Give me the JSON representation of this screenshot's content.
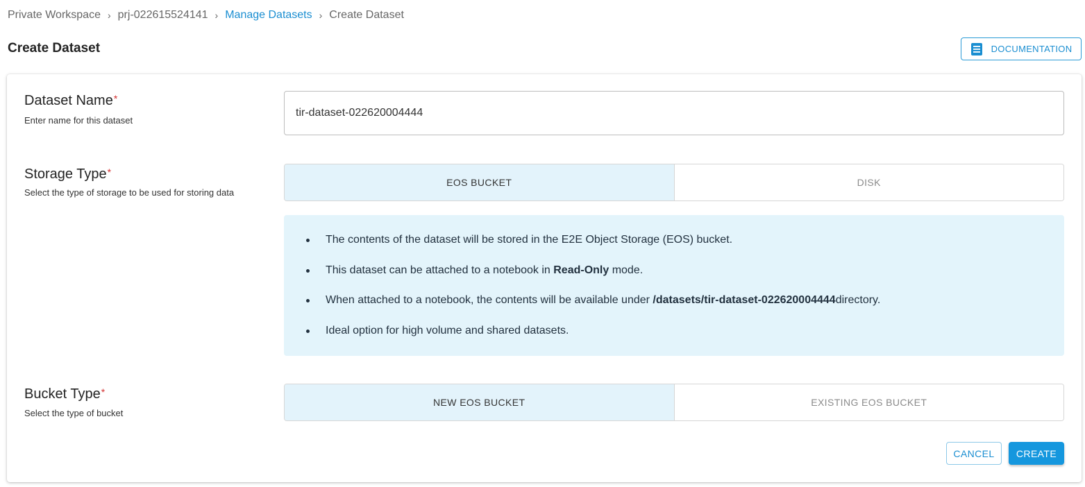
{
  "breadcrumb": {
    "items": [
      "Private Workspace",
      "prj-022615524141",
      "Manage Datasets",
      "Create Dataset"
    ],
    "separator": "›"
  },
  "page": {
    "title": "Create Dataset",
    "documentation_label": "DOCUMENTATION",
    "documentation_icon": "document-icon"
  },
  "form": {
    "dataset_name": {
      "label": "Dataset Name",
      "required_mark": "*",
      "help": "Enter name for this dataset",
      "value": "tir-dataset-022620004444"
    },
    "storage_type": {
      "label": "Storage Type",
      "required_mark": "*",
      "help": "Select the type of storage to be used for storing data",
      "options": [
        "EOS BUCKET",
        "DISK"
      ],
      "selected": "EOS BUCKET"
    },
    "info": {
      "line1": "The contents of the dataset will be stored in the E2E Object Storage (EOS) bucket.",
      "line2_pre": "This dataset can be attached to a notebook in ",
      "line2_bold": "Read-Only",
      "line2_post": " mode.",
      "line3_pre": "When attached to a notebook, the contents will be available under ",
      "line3_bold": "/datasets/tir-dataset-022620004444",
      "line3_post": "directory.",
      "line4": "Ideal option for high volume and shared datasets."
    },
    "bucket_type": {
      "label": "Bucket Type",
      "required_mark": "*",
      "help": "Select the type of bucket",
      "options": [
        "NEW EOS BUCKET",
        "EXISTING EOS BUCKET"
      ],
      "selected": "NEW EOS BUCKET"
    }
  },
  "actions": {
    "cancel_label": "CANCEL",
    "create_label": "CREATE"
  },
  "colors": {
    "accent": "#1597de",
    "link": "#1a8ed1",
    "selected_option_bg": "#e3f3fb",
    "info_bg": "#e3f4fb",
    "required": "#d32f2f"
  }
}
